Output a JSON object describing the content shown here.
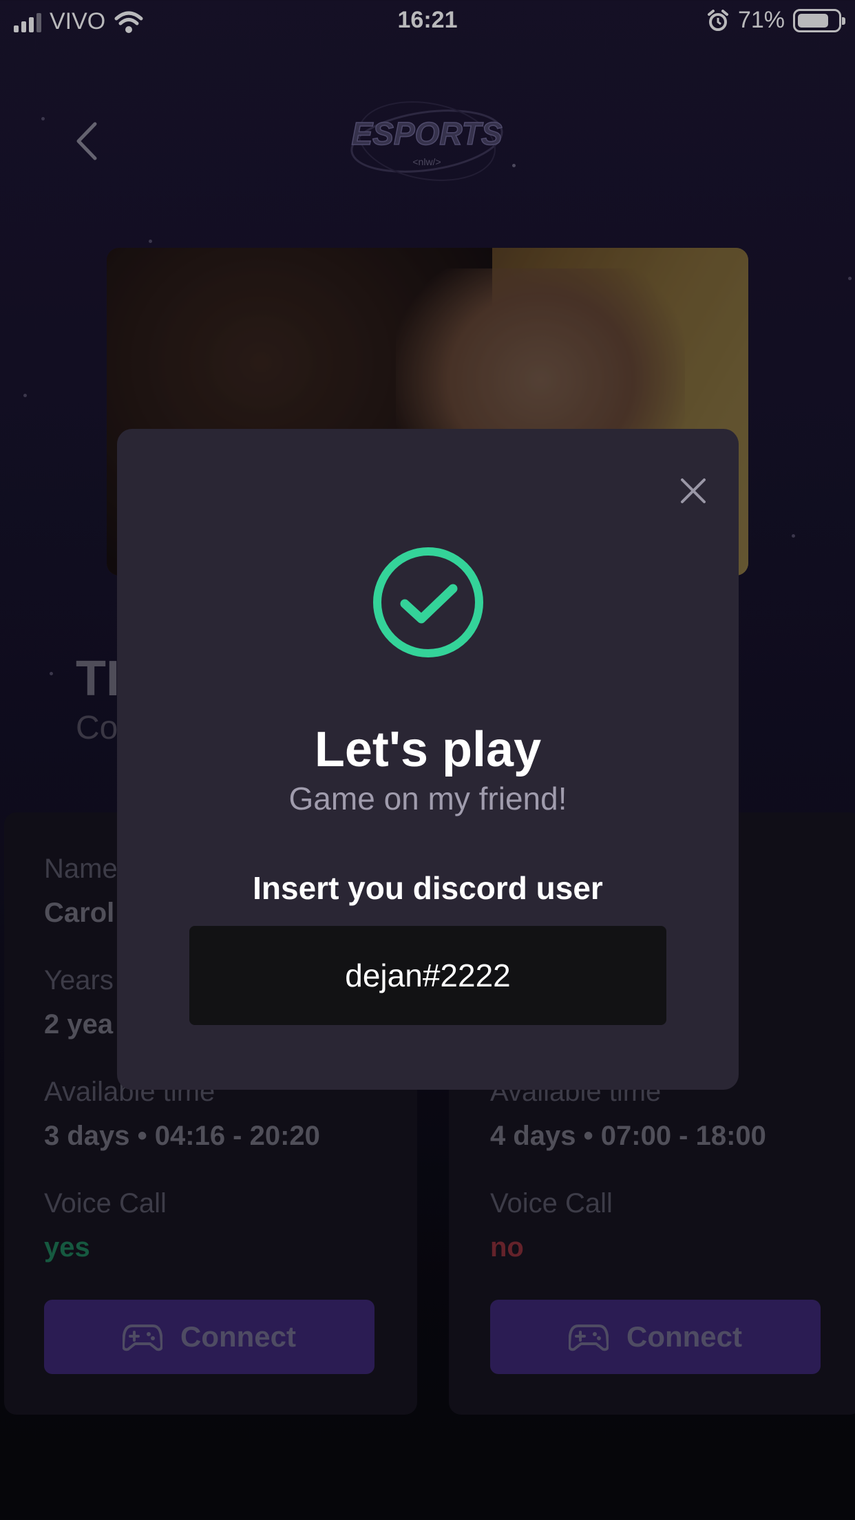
{
  "status_bar": {
    "carrier": "VIVO",
    "time": "16:21",
    "battery": "71%",
    "battery_level": 0.71
  },
  "header": {
    "logo_text": "ESPORTS",
    "logo_sub": "<nlw/>"
  },
  "game": {
    "title": "TI",
    "subtitle": "Co"
  },
  "ads": [
    {
      "name_label": "Name",
      "name_value": "Carol",
      "years_label": "Years",
      "years_value": "2 yea",
      "available_label": "Available time",
      "available_value": "3 days • 04:16 - 20:20",
      "voice_label": "Voice Call",
      "voice_value": "yes",
      "voice_color": "#1e7a55",
      "connect_label": "Connect"
    },
    {
      "available_label": "Available time",
      "available_value": "4 days • 07:00 - 18:00",
      "voice_label": "Voice Call",
      "voice_value": "no",
      "voice_color": "#8a2e36",
      "connect_label": "Connect"
    }
  ],
  "modal": {
    "title": "Let's play",
    "subtitle": "Game on my friend!",
    "label": "Insert you discord user",
    "discord_value": "dejan#2222",
    "accent_color": "#34d399"
  }
}
